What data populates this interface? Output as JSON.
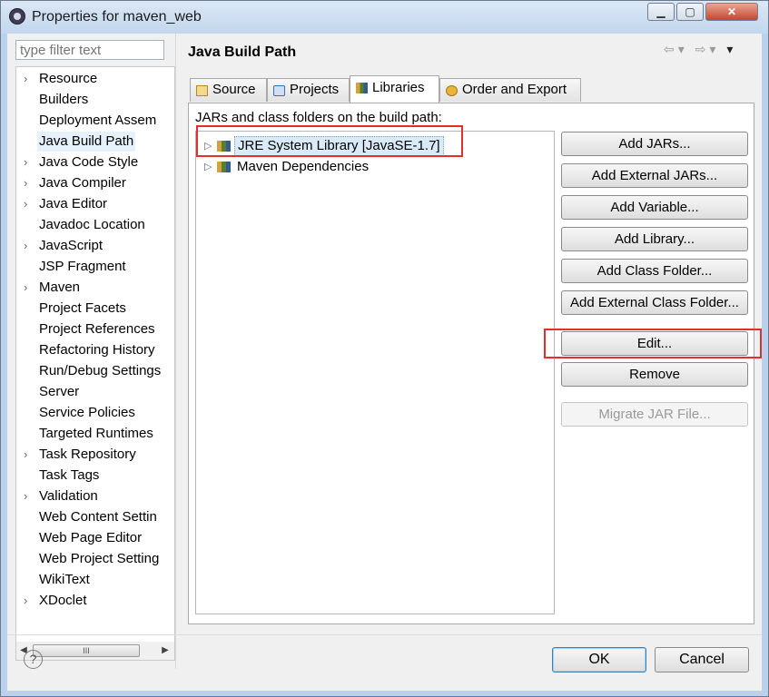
{
  "window": {
    "title": "Properties for maven_web"
  },
  "filter": {
    "placeholder": "type filter text"
  },
  "nav_tree": [
    {
      "label": "Resource",
      "expandable": true
    },
    {
      "label": "Builders",
      "expandable": false
    },
    {
      "label": "Deployment Assem",
      "expandable": false
    },
    {
      "label": "Java Build Path",
      "expandable": false,
      "selected": true
    },
    {
      "label": "Java Code Style",
      "expandable": true
    },
    {
      "label": "Java Compiler",
      "expandable": true
    },
    {
      "label": "Java Editor",
      "expandable": true
    },
    {
      "label": "Javadoc Location",
      "expandable": false
    },
    {
      "label": "JavaScript",
      "expandable": true
    },
    {
      "label": "JSP Fragment",
      "expandable": false
    },
    {
      "label": "Maven",
      "expandable": true
    },
    {
      "label": "Project Facets",
      "expandable": false
    },
    {
      "label": "Project References",
      "expandable": false
    },
    {
      "label": "Refactoring History",
      "expandable": false
    },
    {
      "label": "Run/Debug Settings",
      "expandable": false
    },
    {
      "label": "Server",
      "expandable": false
    },
    {
      "label": "Service Policies",
      "expandable": false
    },
    {
      "label": "Targeted Runtimes",
      "expandable": false
    },
    {
      "label": "Task Repository",
      "expandable": true
    },
    {
      "label": "Task Tags",
      "expandable": false
    },
    {
      "label": "Validation",
      "expandable": true
    },
    {
      "label": "Web Content Settin",
      "expandable": false
    },
    {
      "label": "Web Page Editor",
      "expandable": false
    },
    {
      "label": "Web Project Setting",
      "expandable": false
    },
    {
      "label": "WikiText",
      "expandable": false
    },
    {
      "label": "XDoclet",
      "expandable": true
    }
  ],
  "page": {
    "title": "Java Build Path"
  },
  "tabs": [
    {
      "label": "Source",
      "icon": "source-folder-icon"
    },
    {
      "label": "Projects",
      "icon": "project-icon"
    },
    {
      "label": "Libraries",
      "icon": "library-icon",
      "active": true
    },
    {
      "label": "Order and Export",
      "icon": "order-export-icon"
    }
  ],
  "libraries": {
    "caption": "JARs and class folders on the build path:",
    "entries": [
      {
        "label": "JRE System Library [JavaSE-1.7]",
        "selected": true
      },
      {
        "label": "Maven Dependencies",
        "selected": false
      }
    ]
  },
  "buttons": {
    "add_jars": "Add JARs...",
    "add_external_jars": "Add External JARs...",
    "add_variable": "Add Variable...",
    "add_library": "Add Library...",
    "add_class_folder": "Add Class Folder...",
    "add_external_class_folder": "Add External Class Folder...",
    "edit": "Edit...",
    "remove": "Remove",
    "migrate_jar": "Migrate JAR File..."
  },
  "dialog": {
    "ok": "OK",
    "cancel": "Cancel"
  },
  "colors": {
    "highlight": "#e0302e",
    "selection": "#d9ebf9"
  }
}
